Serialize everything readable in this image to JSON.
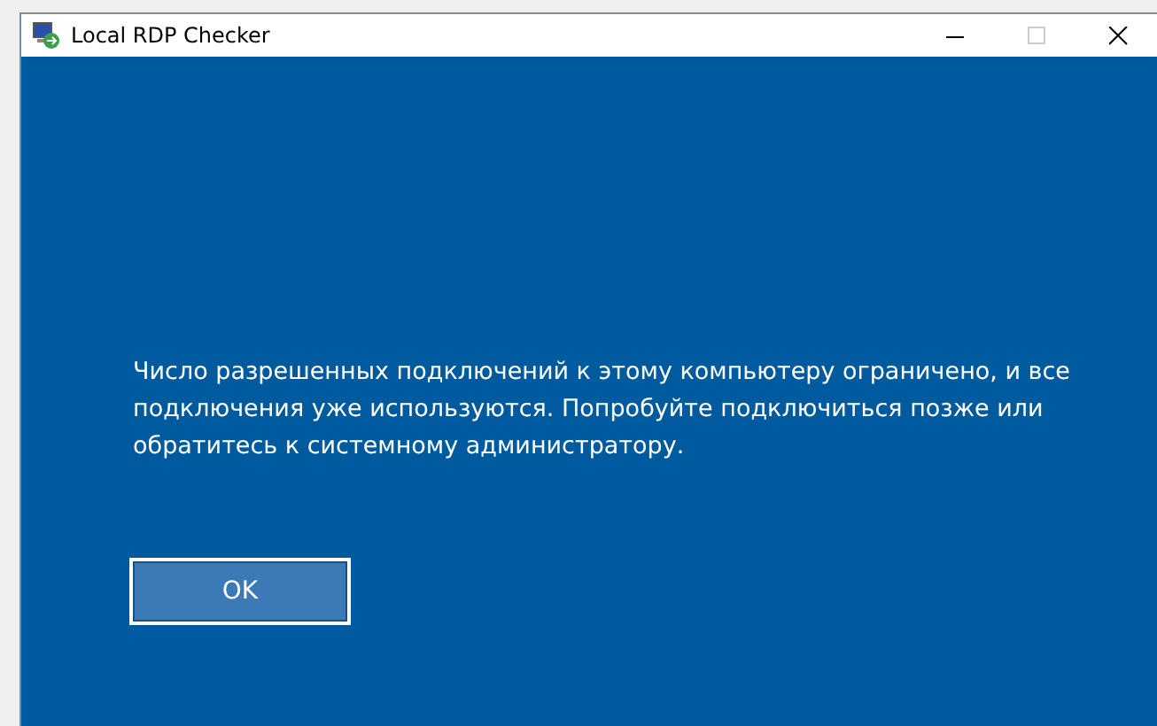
{
  "window": {
    "title": "Local RDP Checker"
  },
  "message": "Число разрешенных подключений к этому компьютеру ограничено, и все подключения уже используются. Попробуйте подключиться позже или обратитесь к системному администратору.",
  "buttons": [
    "OK"
  ]
}
